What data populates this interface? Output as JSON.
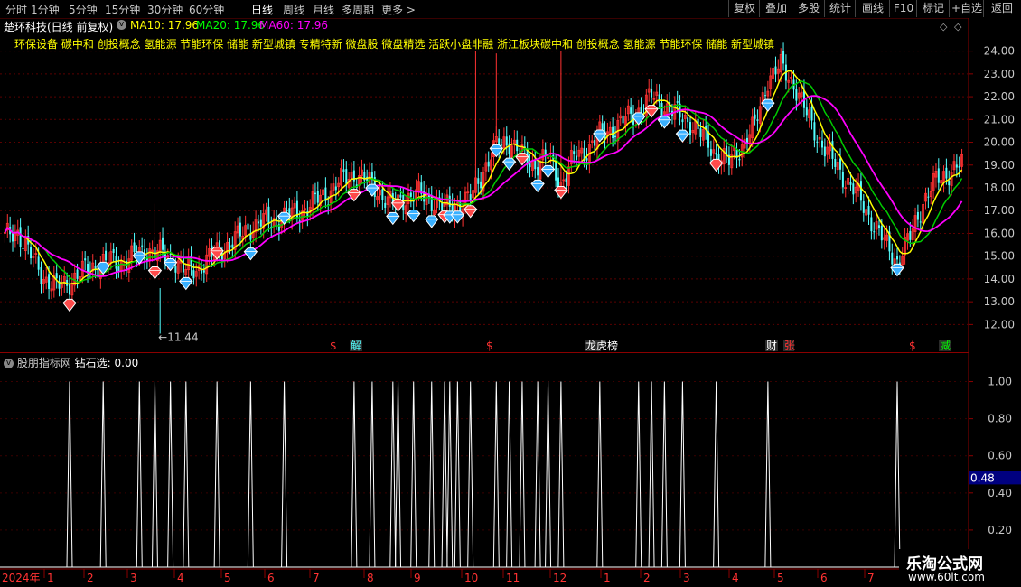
{
  "toolbar": {
    "periods": [
      "分时",
      "1分钟",
      "5分钟",
      "15分钟",
      "30分钟",
      "60分钟",
      "日线",
      "周线",
      "月线",
      "多周期",
      "更多 >"
    ],
    "active_period": "日线",
    "right_buttons": [
      "复权",
      "叠加",
      "多股",
      "统计",
      "画线",
      "F10",
      "标记",
      "+自选",
      "返回"
    ]
  },
  "stock": {
    "title": "楚环科技(日线 前复权)",
    "ma10_label": "MA10: 17.96",
    "ma20_label": "MA20: 17.96",
    "ma60_label": "MA60: 17.96",
    "concepts": "环保设备 碳中和 创投概念 氢能源 节能环保 储能 新型城镇 专精特新 微盘股 微盘精选 活跃小盘非融 浙江板块碳中和 创投概念 氢能源 节能环保 储能 新型城镇",
    "low_marker": "11.44",
    "colors": {
      "ma10": "#ffff00",
      "ma20": "#00cc00",
      "ma60": "#ff00ff",
      "up": "#ff3232",
      "down": "#54ffff"
    }
  },
  "events": [
    {
      "label": "$",
      "color": "#ff3232"
    },
    {
      "label": "解",
      "color": "#54ffff"
    },
    {
      "label": "$",
      "color": "#ff3232"
    },
    {
      "label": "龙虎榜",
      "color": "#ffffff"
    },
    {
      "label": "财",
      "color": "#ffffff"
    },
    {
      "label": "张",
      "color": "#ff3232"
    },
    {
      "label": "$",
      "color": "#ff3232"
    },
    {
      "label": "减",
      "color": "#00ff00"
    }
  ],
  "indicator": {
    "name": "股朋指标网",
    "formula": "钻石选: 0.00",
    "cursor_value": "0.48"
  },
  "time_axis": {
    "year_label": "2024年",
    "months": [
      "1",
      "2",
      "3",
      "4",
      "5",
      "6",
      "7",
      "8",
      "9",
      "10",
      "11",
      "12",
      "1",
      "2",
      "3",
      "4",
      "5",
      "6",
      "7"
    ]
  },
  "watermark": {
    "line1": "乐淘公式网",
    "line2": "www.60lt.com"
  },
  "chart_data": [
    {
      "type": "candlestick",
      "title": "楚环科技(日线 前复权)",
      "ylim": [
        11.5,
        24.5
      ],
      "y_ticks": [
        12.0,
        13.0,
        14.0,
        15.0,
        16.0,
        17.0,
        18.0,
        19.0,
        20.0,
        21.0,
        22.0,
        23.0,
        24.0
      ],
      "close_anchors": [
        [
          0,
          15.8
        ],
        [
          5,
          16.1
        ],
        [
          10,
          15.0
        ],
        [
          15,
          14.1
        ],
        [
          20,
          13.6
        ],
        [
          25,
          13.9
        ],
        [
          30,
          14.3
        ],
        [
          35,
          14.6
        ],
        [
          40,
          14.8
        ],
        [
          45,
          14.7
        ],
        [
          50,
          15.0
        ],
        [
          55,
          15.3
        ],
        [
          60,
          15.1
        ],
        [
          65,
          14.9
        ],
        [
          70,
          14.3
        ],
        [
          75,
          14.5
        ],
        [
          80,
          15.0
        ],
        [
          85,
          15.4
        ],
        [
          90,
          15.8
        ],
        [
          95,
          16.3
        ],
        [
          100,
          16.5
        ],
        [
          105,
          16.6
        ],
        [
          110,
          16.8
        ],
        [
          115,
          17.0
        ],
        [
          120,
          17.4
        ],
        [
          125,
          17.8
        ],
        [
          130,
          18.3
        ],
        [
          135,
          18.6
        ],
        [
          140,
          18.3
        ],
        [
          145,
          17.8
        ],
        [
          150,
          17.2
        ],
        [
          155,
          17.6
        ],
        [
          160,
          17.7
        ],
        [
          165,
          17.5
        ],
        [
          170,
          17.1
        ],
        [
          175,
          17.3
        ],
        [
          180,
          17.5
        ],
        [
          185,
          18.8
        ],
        [
          190,
          19.8
        ],
        [
          195,
          20.1
        ],
        [
          200,
          19.4
        ],
        [
          205,
          19.0
        ],
        [
          210,
          19.4
        ],
        [
          215,
          18.2
        ],
        [
          220,
          19.3
        ],
        [
          225,
          19.7
        ],
        [
          230,
          20.3
        ],
        [
          235,
          20.6
        ],
        [
          240,
          21.0
        ],
        [
          245,
          21.4
        ],
        [
          250,
          22.0
        ],
        [
          255,
          21.6
        ],
        [
          260,
          21.2
        ],
        [
          265,
          20.9
        ],
        [
          270,
          20.2
        ],
        [
          275,
          19.5
        ],
        [
          280,
          19.1
        ],
        [
          285,
          19.9
        ],
        [
          290,
          20.7
        ],
        [
          295,
          22.8
        ],
        [
          300,
          23.3
        ],
        [
          305,
          22.6
        ],
        [
          310,
          21.2
        ],
        [
          315,
          20.1
        ],
        [
          320,
          19.2
        ],
        [
          325,
          18.4
        ],
        [
          330,
          17.6
        ],
        [
          335,
          16.6
        ],
        [
          340,
          15.6
        ],
        [
          345,
          14.8
        ],
        [
          350,
          15.8
        ],
        [
          355,
          17.4
        ],
        [
          360,
          18.3
        ],
        [
          365,
          18.7
        ],
        [
          370,
          19.0
        ]
      ],
      "ma_series": [
        "MA10",
        "MA20",
        "MA60"
      ],
      "signal_diamond_days": [
        25,
        38,
        52,
        58,
        64,
        70,
        82,
        95,
        108,
        135,
        142,
        150,
        152,
        158,
        165,
        170,
        172,
        175,
        180,
        190,
        195,
        200,
        206,
        210,
        215,
        230,
        245,
        250,
        255,
        262,
        275,
        295,
        345
      ],
      "spikes_high": [
        [
          58,
          17.3
        ],
        [
          182,
          24.0
        ],
        [
          190,
          23.9
        ],
        [
          215,
          24.0
        ]
      ],
      "low_marker_day": 60
    },
    {
      "type": "line",
      "title": "钻石选",
      "ylim": [
        0,
        1.1
      ],
      "y_ticks": [
        0.2,
        0.4,
        0.6,
        0.8,
        1.0
      ],
      "values_nonzero_days": [
        25,
        38,
        52,
        58,
        64,
        70,
        82,
        95,
        108,
        135,
        142,
        150,
        152,
        158,
        165,
        170,
        172,
        175,
        180,
        190,
        195,
        200,
        206,
        210,
        215,
        230,
        245,
        250,
        255,
        262,
        275,
        295,
        345
      ],
      "value": 1.0
    }
  ]
}
